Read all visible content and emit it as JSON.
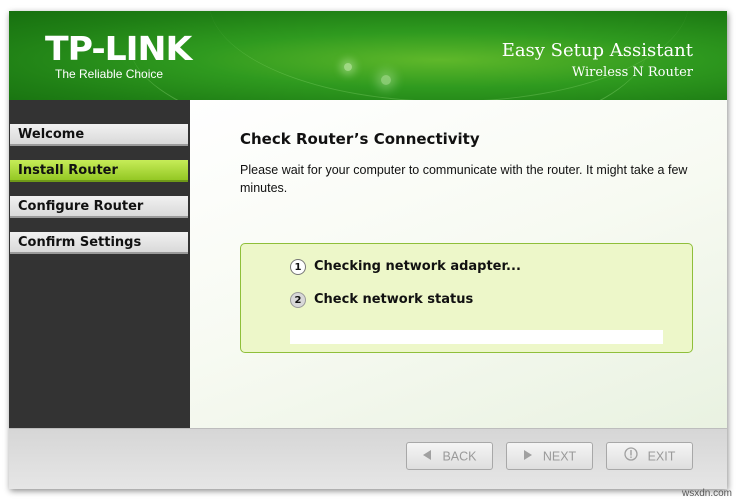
{
  "header": {
    "brand": "TP-LINK",
    "tagline": "The Reliable Choice",
    "app_title": "Easy Setup Assistant",
    "app_subtitle": "Wireless N Router"
  },
  "sidebar": {
    "items": [
      {
        "label": "Welcome",
        "active": false
      },
      {
        "label": "Install Router",
        "active": true
      },
      {
        "label": "Configure Router",
        "active": false
      },
      {
        "label": "Confirm Settings",
        "active": false
      }
    ]
  },
  "main": {
    "title": "Check Router’s Connectivity",
    "description": "Please wait for your computer to communicate with the router. It might take a few minutes.",
    "steps": [
      {
        "number": "1",
        "label": "Checking network adapter...",
        "state": "current"
      },
      {
        "number": "2",
        "label": "Check network status",
        "state": "pending"
      }
    ],
    "progress": 0
  },
  "footer": {
    "back_label": "BACK",
    "next_label": "NEXT",
    "exit_label": "EXIT"
  },
  "watermark": "wsxdn.com",
  "colors": {
    "header_green": "#2f9a1f",
    "active_item": "#a8d63a",
    "panel_bg": "#edf7c9",
    "panel_border": "#8fbf3a",
    "sidebar_bg": "#333333"
  },
  "icons": {
    "back": "triangle-left-icon",
    "next": "triangle-right-icon",
    "exit": "info-circle-icon"
  }
}
